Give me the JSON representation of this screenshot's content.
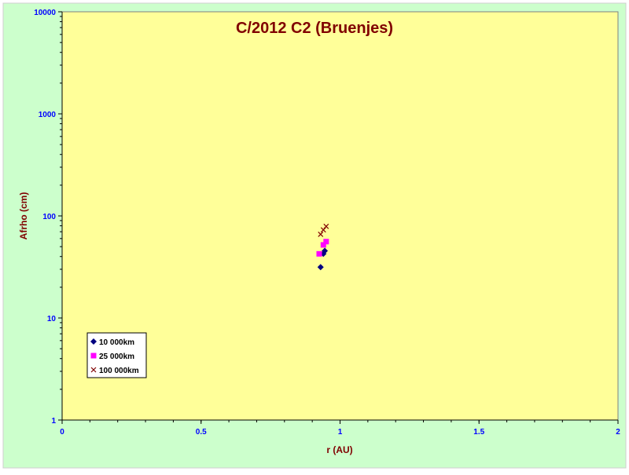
{
  "chart_data": {
    "type": "scatter",
    "title": "C/2012 C2 (Bruenjes)",
    "xlabel": "r (AU)",
    "ylabel": "Afrho (cm)",
    "xlim": [
      0,
      2
    ],
    "ylim": [
      1,
      10000
    ],
    "yscale": "log",
    "x_ticks": [
      {
        "value": 0,
        "label": "0"
      },
      {
        "value": 0.5,
        "label": "0.5"
      },
      {
        "value": 1,
        "label": "1"
      },
      {
        "value": 1.5,
        "label": "1.5"
      },
      {
        "value": 2,
        "label": "2"
      }
    ],
    "y_ticks": [
      {
        "value": 1,
        "label": "1"
      },
      {
        "value": 10,
        "label": "10"
      },
      {
        "value": 100,
        "label": "100"
      },
      {
        "value": 1000,
        "label": "1000"
      },
      {
        "value": 10000,
        "label": "10000"
      }
    ],
    "grid": false,
    "legend_position": "bottom-left",
    "series": [
      {
        "name": "10 000km",
        "marker": "diamond",
        "color": "#000080",
        "x": [
          0.93,
          0.94,
          0.945
        ],
        "y": [
          31.5,
          42.5,
          45.5
        ]
      },
      {
        "name": "25 000km",
        "marker": "square",
        "color": "#ff00ff",
        "x": [
          0.925,
          0.94,
          0.95
        ],
        "y": [
          42.5,
          52,
          56
        ]
      },
      {
        "name": "100 000km",
        "marker": "x",
        "color": "#800000",
        "x": [
          0.93,
          0.94,
          0.95
        ],
        "y": [
          66,
          73,
          79
        ]
      }
    ],
    "colors": {
      "outer_background": "#ccffcc",
      "plot_background": "#ffff99",
      "title": "#800000",
      "axis_title": "#800000",
      "tick_label": "#0000ff"
    }
  }
}
